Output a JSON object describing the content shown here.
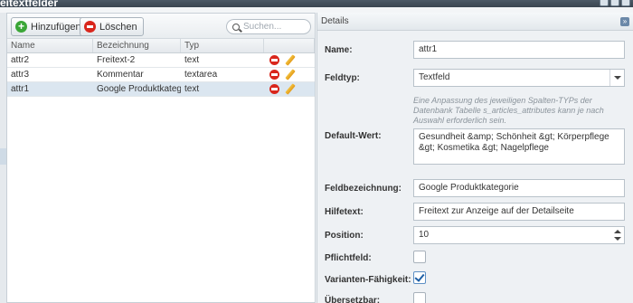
{
  "window": {
    "title": "eitextfelder"
  },
  "toolbar": {
    "add_label": "Hinzufügen",
    "delete_label": "Löschen",
    "search_placeholder": "Suchen..."
  },
  "grid": {
    "columns": [
      "Name",
      "Bezeichnung",
      "Typ"
    ],
    "rows": [
      {
        "name": "attr2",
        "label": "Freitext-2",
        "type": "text"
      },
      {
        "name": "attr3",
        "label": "Kommentar",
        "type": "textarea"
      },
      {
        "name": "attr1",
        "label": "Google Produktkatego...",
        "type": "text"
      }
    ]
  },
  "details": {
    "title": "Details",
    "name_label": "Name:",
    "name_value": "attr1",
    "type_label": "Feldtyp:",
    "type_value": "Textfeld",
    "type_help": "Eine Anpassung des jeweiligen Spalten-TYPs der Datenbank Tabelle s_articles_attributes kann je nach Auswahl erforderlich sein.",
    "default_label": "Default-Wert:",
    "default_value": "Gesundheit &amp; Schönheit &gt; Körperpflege &gt; Kosmetika &gt; Nagelpflege",
    "caption_label": "Feldbezeichnung:",
    "caption_value": "Google Produktkategorie",
    "helptext_label": "Hilfetext:",
    "helptext_value": "Freitext zur Anzeige auf der Detailseite",
    "position_label": "Position:",
    "position_value": "10",
    "required_label": "Pflichtfeld:",
    "variant_label": "Varianten-Fähigkeit:",
    "translatable_label": "Übersetzbar:"
  }
}
